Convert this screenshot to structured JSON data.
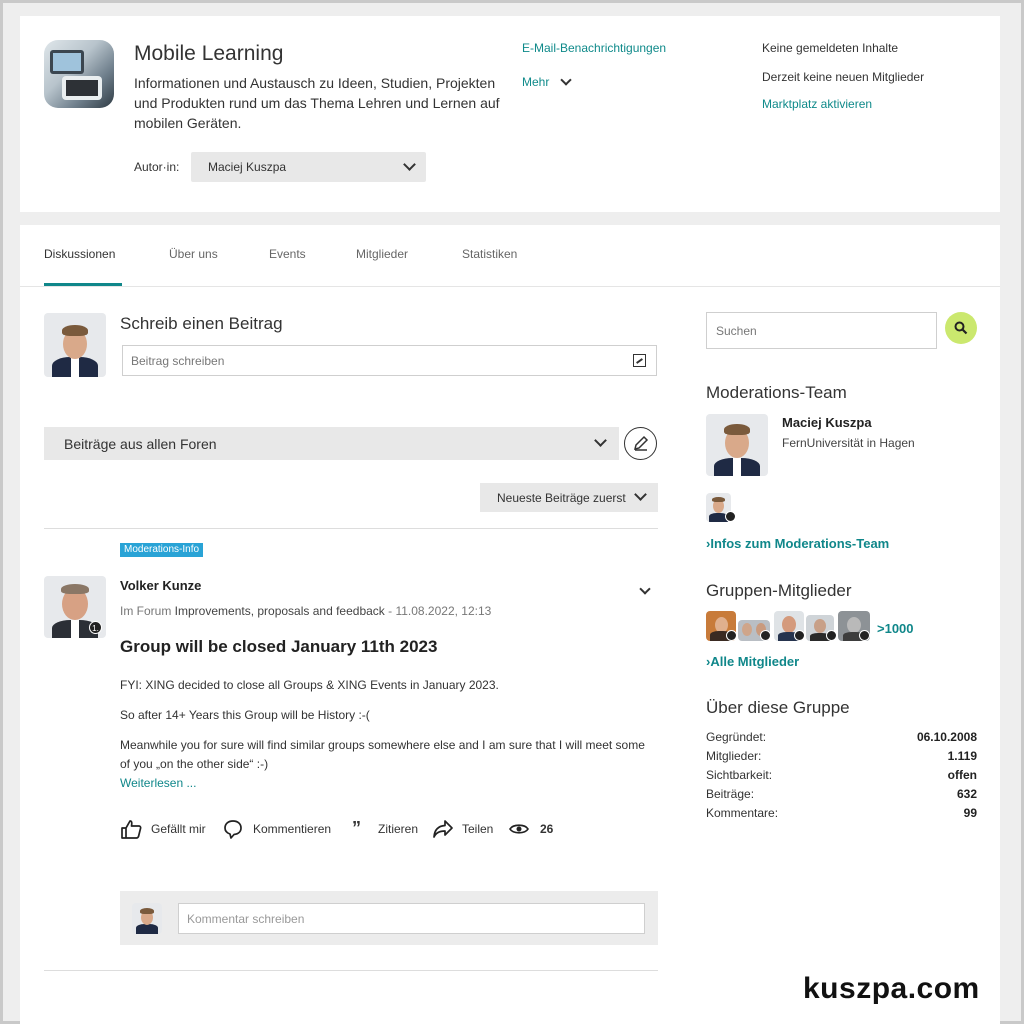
{
  "header": {
    "title": "Mobile Learning",
    "description": "Informationen und Austausch zu Ideen, Studien, Projekten und Produkten rund um das Thema Lehren und Lernen auf mobilen Geräten.",
    "author_label": "Autor·in:",
    "author_value": "Maciej Kuszpa",
    "email_link": "E-Mail-Benachrichtigungen",
    "more_label": "Mehr",
    "info_reported": "Keine gemeldeten Inhalte",
    "info_members": "Derzeit keine neuen Mitglieder",
    "marketplace_link": "Marktplatz aktivieren"
  },
  "tabs": [
    {
      "label": "Diskussionen"
    },
    {
      "label": "Über uns"
    },
    {
      "label": "Events"
    },
    {
      "label": "Mitglieder"
    },
    {
      "label": "Statistiken"
    }
  ],
  "compose": {
    "title": "Schreib einen Beitrag",
    "placeholder": "Beitrag schreiben"
  },
  "filters": {
    "forum": "Beiträge aus allen Foren",
    "sort": "Neueste Beiträge zuerst"
  },
  "post": {
    "tag": "Moderations-Info",
    "author": "Volker Kunze",
    "meta_prefix": "Im Forum ",
    "forum": "Improvements, proposals and feedback",
    "meta_suffix": " - 11.08.2022, 12:13",
    "title": "Group will be closed January 11th 2023",
    "p1": "FYI: XING decided to close all Groups & XING Events in January 2023.",
    "p2": "So after 14+ Years this Group will be History :-(",
    "p3": "Meanwhile you for sure will find similar groups somewhere else and I am sure that I will meet some of you „on the other side“ :-)",
    "read_more": "Weiterlesen ...",
    "badge": "1.",
    "actions": {
      "like": "Gefällt mir",
      "comment": "Kommentieren",
      "quote": "Zitieren",
      "share": "Teilen",
      "views": "26"
    },
    "comment_placeholder": "Kommentar schreiben"
  },
  "sidebar": {
    "search_placeholder": "Suchen",
    "mod_heading": "Moderations-Team",
    "mod_name": "Maciej Kuszpa",
    "mod_org": "FernUniversität in Hagen",
    "mod_link": "Infos zum Moderations-Team",
    "members_heading": "Gruppen-Mitglieder",
    "members_count": ">1000",
    "members_link": "Alle Mitglieder",
    "about_heading": "Über diese Gruppe",
    "stats": [
      {
        "label": "Gegründet:",
        "value": "06.10.2008"
      },
      {
        "label": "Mitglieder:",
        "value": "1.119"
      },
      {
        "label": "Sichtbarkeit:",
        "value": "offen"
      },
      {
        "label": "Beiträge:",
        "value": "632"
      },
      {
        "label": "Kommentare:",
        "value": "99"
      }
    ]
  },
  "watermark": "kuszpa.com",
  "colors": {
    "accent": "#10878a",
    "tag_blue": "#29a3d6",
    "search_green": "#cbe86e"
  }
}
